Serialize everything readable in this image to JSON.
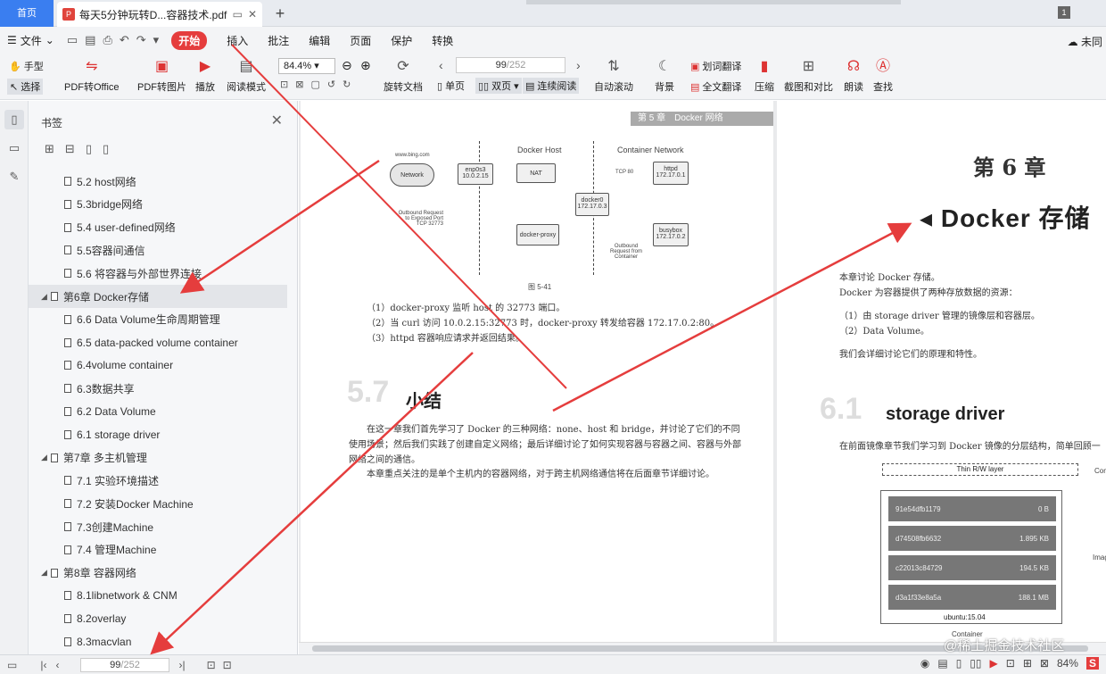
{
  "tabs": {
    "home": "首页",
    "doc": "每天5分钟玩转D...容器技术.pdf",
    "page_badge": "1"
  },
  "menu": {
    "file": "文件",
    "items": [
      "开始",
      "插入",
      "批注",
      "编辑",
      "页面",
      "保护",
      "转换"
    ],
    "cloud": "未同"
  },
  "toolbar": {
    "hand": "手型",
    "select": "选择",
    "pdf2office": "PDF转Office",
    "pdf2img": "PDF转图片",
    "play": "播放",
    "readmode": "阅读模式",
    "zoom": "84.4%",
    "rotate": "旋转文档",
    "single": "单页",
    "double": "双页",
    "continuous": "连续阅读",
    "autoscroll": "自动滚动",
    "background": "背景",
    "wordtrans": "划词翻译",
    "fulltrans": "全文翻译",
    "compress": "压缩",
    "screenshot": "截图和对比",
    "read": "朗读",
    "find": "查找",
    "page_current": "99",
    "page_total": "/252"
  },
  "panel": {
    "title": "书签",
    "items": [
      {
        "label": "5.2 host网络",
        "level": 2
      },
      {
        "label": "5.3bridge网络",
        "level": 2
      },
      {
        "label": "5.4 user-defined网络",
        "level": 2
      },
      {
        "label": "5.5容器间通信",
        "level": 2
      },
      {
        "label": "5.6 将容器与外部世界连接",
        "level": 2
      },
      {
        "label": "第6章 Docker存储",
        "level": 1,
        "selected": true
      },
      {
        "label": "6.6 Data Volume生命周期管理",
        "level": 2
      },
      {
        "label": "6.5 data-packed volume container",
        "level": 2
      },
      {
        "label": "6.4volume container",
        "level": 2
      },
      {
        "label": "6.3数据共享",
        "level": 2
      },
      {
        "label": "6.2 Data Volume",
        "level": 2
      },
      {
        "label": "6.1 storage driver",
        "level": 2
      },
      {
        "label": "第7章 多主机管理",
        "level": 1
      },
      {
        "label": "7.1 实验环境描述",
        "level": 2
      },
      {
        "label": "7.2 安装Docker Machine",
        "level": 2
      },
      {
        "label": "7.3创建Machine",
        "level": 2
      },
      {
        "label": "7.4 管理Machine",
        "level": 2
      },
      {
        "label": "第8章 容器网络",
        "level": 1
      },
      {
        "label": "8.1libnetwork & CNM",
        "level": 2
      },
      {
        "label": "8.2overlay",
        "level": 2
      },
      {
        "label": "8.3macvlan",
        "level": 2
      }
    ]
  },
  "left_page": {
    "header": "第 5 章　Docker 网络",
    "diagram": {
      "host": "Docker Host",
      "container_net": "Container Network",
      "bing": "www.bing.com",
      "network": "Network",
      "enp": "enp0s3",
      "enp_ip": "10.0.2.15",
      "nat": "NAT",
      "tcp": "TCP 80",
      "httpd": "httpd",
      "httpd_ip": "172.17.0.1",
      "docker0": "docker0",
      "docker0_ip": "172.17.0.3",
      "proxy": "docker-proxy",
      "busybox": "busybox",
      "busybox_ip": "172.17.0.2",
      "outbound": "Outbound Request to Exposed Port TCP 32773",
      "outbound2": "Outbound Request from Container",
      "caption": "图 5-41"
    },
    "steps": [
      "（1）docker-proxy 监听 host 的 32773 端口。",
      "（2）当 curl 访问 10.0.2.15:32773 时，docker-proxy 转发给容器 172.17.0.2:80。",
      "（3）httpd 容器响应请求并返回结果。"
    ],
    "section_num": "5.7",
    "section_title": "小结",
    "para1": "在这一章我们首先学习了 Docker 的三种网络：none、host 和 bridge，并讨论了它们的不同使用场景；然后我们实践了创建自定义网络；最后详细讨论了如何实现容器与容器之间、容器与外部网络之间的通信。",
    "para2": "本章重点关注的是单个主机内的容器网络，对于跨主机网络通信将在后面章节详细讨论。"
  },
  "right_page": {
    "chapter": "第 6 章",
    "title": "Docker 存储",
    "intro1": "本章讨论 Docker 存储。",
    "intro2": "Docker 为容器提供了两种存放数据的资源：",
    "li1": "（1）由 storage driver 管理的镜像层和容器层。",
    "li2": "（2）Data Volume。",
    "intro3": "我们会详细讨论它们的原理和特性。",
    "sec_num": "6.1",
    "sec_title": "storage driver",
    "sec_text": "在前面镜像章节我们学习到 Docker 镜像的分层结构，简单回顾一",
    "layers": {
      "rw": "Thin R/W layer",
      "container": "Contain",
      "image": "Image",
      "ubuntu": "ubuntu:15.04",
      "container_lbl": "Container",
      "rows": [
        {
          "id": "91e54dfb1179",
          "size": "0 B"
        },
        {
          "id": "d74508fb6632",
          "size": "1.895 KB"
        },
        {
          "id": "c22013c84729",
          "size": "194.5 KB"
        },
        {
          "id": "d3a1f33e8a5a",
          "size": "188.1 MB"
        }
      ]
    }
  },
  "status": {
    "page_current": "99",
    "page_total": "/252",
    "zoom": "84%"
  },
  "watermark": "@稀土掘金技术社区",
  "colors": {
    "accent": "#e53d3d",
    "home_tab": "#3a7ef0"
  }
}
